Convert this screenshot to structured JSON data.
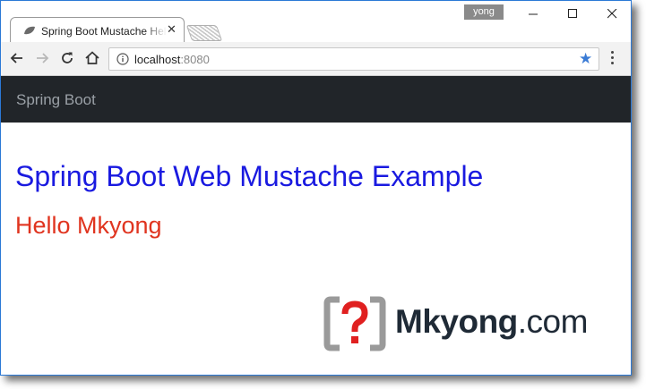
{
  "browser": {
    "tab_title": "Spring Boot Mustache Hello",
    "profile_name": "yong",
    "url_host": "localhost",
    "url_port": ":8080",
    "accent_color": "#3a7bd5"
  },
  "icons": {
    "favicon": "leaf-favicon-icon",
    "tab_close": "close-icon",
    "back": "arrow-left-icon",
    "forward": "arrow-right-icon",
    "reload": "reload-icon",
    "home": "home-icon",
    "info": "info-icon",
    "bookmark": "star-icon",
    "menu": "kebab-menu-icon"
  },
  "page": {
    "navbar_brand": "Spring Boot",
    "heading": "Spring Boot Web Mustache Example",
    "message": "Hello Mkyong",
    "heading_color": "#1a1ae0",
    "message_color": "#e0341f",
    "navbar_color": "#212529"
  },
  "watermark": {
    "brand": "Mkyong",
    "suffix": ".com"
  }
}
